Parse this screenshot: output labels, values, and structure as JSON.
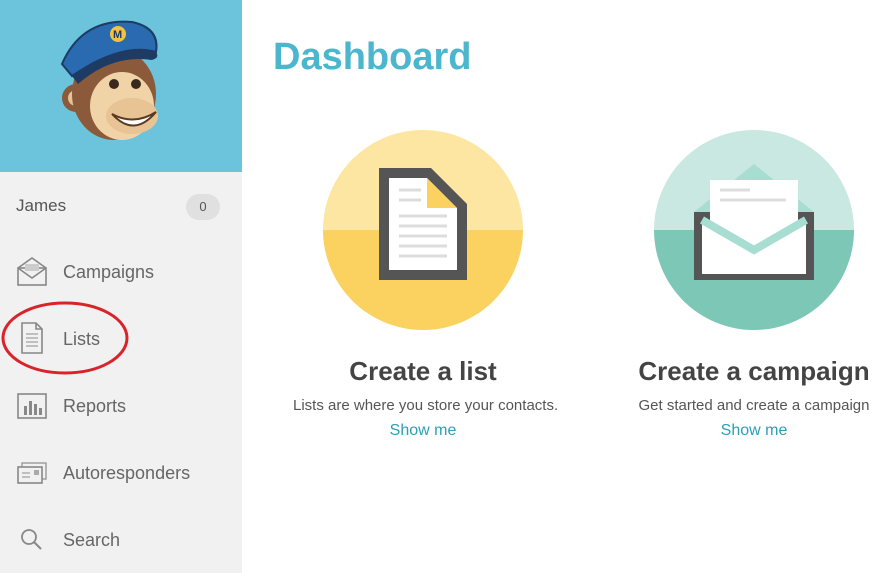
{
  "sidebar": {
    "user": {
      "name": "James",
      "badge": "0"
    },
    "items": [
      {
        "label": "Campaigns",
        "icon": "envelope-icon"
      },
      {
        "label": "Lists",
        "icon": "document-icon"
      },
      {
        "label": "Reports",
        "icon": "bar-chart-icon"
      },
      {
        "label": "Autoresponders",
        "icon": "stacked-mail-icon"
      },
      {
        "label": "Search",
        "icon": "search-icon"
      }
    ]
  },
  "main": {
    "title": "Dashboard",
    "cards": [
      {
        "title": "Create a list",
        "description": "Lists are where you store your contacts.",
        "link": "Show me",
        "icon": "list-document-icon"
      },
      {
        "title": "Create a campaign",
        "description": "Get started and create a campaign",
        "link": "Show me",
        "icon": "open-envelope-icon"
      }
    ]
  },
  "colors": {
    "brand_blue": "#6cc3dc",
    "title_blue": "#4cb6cf",
    "link_blue": "#2b9fb6",
    "list_yellow": "#fbd160",
    "campaign_green": "#7cc7b5",
    "annotation_red": "#d9232a"
  }
}
